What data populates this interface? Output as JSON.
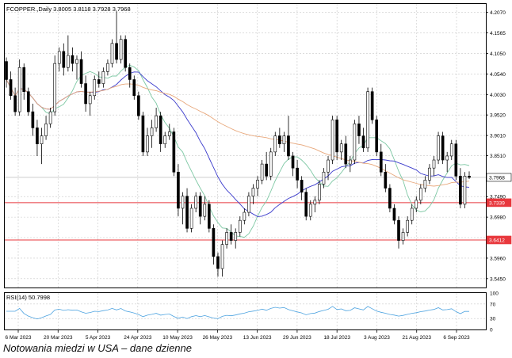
{
  "header": {
    "symbol_line": "FCOPPER.,Daily  3.8005 3.8118 3.7928 3.7968"
  },
  "rsi": {
    "label": "RSI(14) 50.7998",
    "levels": [
      "100",
      "70",
      "30",
      "0"
    ]
  },
  "caption": "Notowania miedzi w USA – dane dzienne",
  "chart_data": {
    "type": "candlestick",
    "title": "FCOPPER.,Daily  3.8005 3.8118 3.7928 3.7968",
    "timeframe": "Daily",
    "ohlc_last": {
      "open": 3.8005,
      "high": 3.8118,
      "low": 3.7928,
      "close": 3.7968
    },
    "ylim": [
      3.523,
      4.228
    ],
    "y_ticks": [
      "4.2070",
      "4.1565",
      "4.1050",
      "4.0540",
      "4.0030",
      "3.9520",
      "3.9010",
      "3.8510",
      "3.7490",
      "3.6980",
      "3.6470",
      "3.5960",
      "3.5450"
    ],
    "x_tick_labels": [
      "6 Mar 2023",
      "20 Mar 2023",
      "5 Apr 2023",
      "24 Apr 2023",
      "10 May 2023",
      "26 May 2023",
      "13 Jun 2023",
      "29 Jun 2023",
      "18 Jul 2023",
      "3 Aug 2023",
      "21 Aug 2023",
      "6 Sep 2023"
    ],
    "price_labels": [
      {
        "text": "3.7968",
        "value": 3.7968,
        "color": "#000000"
      },
      {
        "text": "3.7339",
        "value": 3.7339,
        "color": "#e8383d"
      },
      {
        "text": "3.6412",
        "value": 3.6412,
        "color": "#e8383d"
      }
    ],
    "horizontal_lines": [
      {
        "value": 3.7339,
        "color": "#e8383d"
      },
      {
        "value": 3.6412,
        "color": "#e8383d"
      }
    ],
    "series": [
      {
        "kind": "moving_average",
        "color": "#7ec8a4",
        "role": "fast MA"
      },
      {
        "kind": "moving_average",
        "color": "#3b3bcc",
        "role": "medium MA"
      },
      {
        "kind": "moving_average",
        "color": "#e8a87c",
        "role": "slow MA"
      }
    ],
    "candles": [
      [
        4.085,
        4.095,
        4.02,
        4.04
      ],
      [
        4.04,
        4.06,
        3.99,
        4.0
      ],
      [
        4.0,
        4.02,
        3.95,
        3.96
      ],
      [
        3.96,
        4.09,
        3.95,
        4.07
      ],
      [
        4.07,
        4.08,
        3.99,
        4.01
      ],
      [
        4.01,
        4.02,
        3.95,
        3.96
      ],
      [
        3.96,
        3.98,
        3.9,
        3.92
      ],
      [
        3.92,
        3.94,
        3.85,
        3.88
      ],
      [
        3.88,
        3.92,
        3.83,
        3.9
      ],
      [
        3.9,
        3.95,
        3.89,
        3.93
      ],
      [
        3.93,
        3.97,
        3.92,
        3.96
      ],
      [
        3.96,
        4.1,
        3.95,
        4.08
      ],
      [
        4.08,
        4.12,
        4.06,
        4.11
      ],
      [
        4.11,
        4.13,
        4.05,
        4.07
      ],
      [
        4.07,
        4.15,
        4.06,
        4.1
      ],
      [
        4.1,
        4.12,
        4.06,
        4.08
      ],
      [
        4.08,
        4.1,
        4.04,
        4.09
      ],
      [
        4.09,
        4.11,
        4.02,
        4.03
      ],
      [
        4.03,
        4.05,
        3.96,
        3.98
      ],
      [
        3.98,
        4.01,
        3.95,
        4.0
      ],
      [
        4.0,
        4.05,
        3.99,
        4.04
      ],
      [
        4.04,
        4.06,
        4.02,
        4.03
      ],
      [
        4.03,
        4.07,
        4.02,
        4.06
      ],
      [
        4.06,
        4.09,
        4.05,
        4.08
      ],
      [
        4.08,
        4.14,
        4.07,
        4.13
      ],
      [
        4.13,
        4.21,
        4.08,
        4.09
      ],
      [
        4.09,
        4.15,
        4.08,
        4.14
      ],
      [
        4.14,
        4.15,
        4.06,
        4.07
      ],
      [
        4.07,
        4.08,
        4.02,
        4.04
      ],
      [
        4.04,
        4.05,
        3.99,
        4.0
      ],
      [
        4.0,
        4.01,
        3.94,
        3.95
      ],
      [
        3.95,
        3.96,
        3.85,
        3.86
      ],
      [
        3.86,
        3.92,
        3.85,
        3.9
      ],
      [
        3.9,
        3.94,
        3.87,
        3.92
      ],
      [
        3.92,
        3.97,
        3.91,
        3.95
      ],
      [
        3.95,
        3.96,
        3.86,
        3.88
      ],
      [
        3.88,
        3.91,
        3.87,
        3.9
      ],
      [
        3.9,
        3.93,
        3.89,
        3.91
      ],
      [
        3.91,
        3.92,
        3.8,
        3.81
      ],
      [
        3.81,
        3.83,
        3.7,
        3.72
      ],
      [
        3.72,
        3.76,
        3.68,
        3.75
      ],
      [
        3.75,
        3.77,
        3.66,
        3.67
      ],
      [
        3.67,
        3.73,
        3.66,
        3.72
      ],
      [
        3.72,
        3.76,
        3.71,
        3.75
      ],
      [
        3.75,
        3.76,
        3.68,
        3.7
      ],
      [
        3.7,
        3.75,
        3.69,
        3.73
      ],
      [
        3.73,
        3.74,
        3.66,
        3.67
      ],
      [
        3.67,
        3.68,
        3.58,
        3.6
      ],
      [
        3.6,
        3.61,
        3.55,
        3.57
      ],
      [
        3.57,
        3.64,
        3.55,
        3.63
      ],
      [
        3.63,
        3.67,
        3.62,
        3.66
      ],
      [
        3.66,
        3.68,
        3.63,
        3.64
      ],
      [
        3.64,
        3.67,
        3.62,
        3.66
      ],
      [
        3.66,
        3.7,
        3.65,
        3.69
      ],
      [
        3.69,
        3.72,
        3.68,
        3.71
      ],
      [
        3.71,
        3.76,
        3.7,
        3.75
      ],
      [
        3.75,
        3.78,
        3.73,
        3.77
      ],
      [
        3.77,
        3.8,
        3.75,
        3.79
      ],
      [
        3.79,
        3.84,
        3.78,
        3.83
      ],
      [
        3.83,
        3.86,
        3.79,
        3.8
      ],
      [
        3.8,
        3.87,
        3.79,
        3.86
      ],
      [
        3.86,
        3.91,
        3.85,
        3.9
      ],
      [
        3.9,
        3.92,
        3.87,
        3.88
      ],
      [
        3.88,
        3.91,
        3.86,
        3.9
      ],
      [
        3.9,
        3.95,
        3.84,
        3.85
      ],
      [
        3.85,
        3.86,
        3.8,
        3.82
      ],
      [
        3.82,
        3.84,
        3.77,
        3.79
      ],
      [
        3.79,
        3.8,
        3.74,
        3.76
      ],
      [
        3.76,
        3.77,
        3.69,
        3.7
      ],
      [
        3.7,
        3.74,
        3.69,
        3.73
      ],
      [
        3.73,
        3.75,
        3.71,
        3.74
      ],
      [
        3.74,
        3.79,
        3.73,
        3.78
      ],
      [
        3.78,
        3.82,
        3.77,
        3.81
      ],
      [
        3.81,
        3.85,
        3.79,
        3.84
      ],
      [
        3.84,
        3.95,
        3.83,
        3.94
      ],
      [
        3.94,
        3.95,
        3.84,
        3.86
      ],
      [
        3.86,
        3.89,
        3.84,
        3.88
      ],
      [
        3.88,
        3.9,
        3.82,
        3.83
      ],
      [
        3.83,
        3.85,
        3.81,
        3.84
      ],
      [
        3.84,
        3.94,
        3.83,
        3.93
      ],
      [
        3.93,
        3.95,
        3.88,
        3.9
      ],
      [
        3.9,
        3.92,
        3.86,
        3.87
      ],
      [
        3.87,
        4.02,
        3.86,
        4.01
      ],
      [
        4.01,
        4.02,
        3.93,
        3.94
      ],
      [
        3.94,
        3.95,
        3.85,
        3.86
      ],
      [
        3.86,
        3.88,
        3.8,
        3.81
      ],
      [
        3.81,
        3.83,
        3.76,
        3.77
      ],
      [
        3.77,
        3.78,
        3.71,
        3.72
      ],
      [
        3.72,
        3.73,
        3.68,
        3.69
      ],
      [
        3.69,
        3.7,
        3.62,
        3.64
      ],
      [
        3.64,
        3.67,
        3.63,
        3.66
      ],
      [
        3.66,
        3.7,
        3.65,
        3.69
      ],
      [
        3.69,
        3.73,
        3.68,
        3.72
      ],
      [
        3.72,
        3.75,
        3.71,
        3.74
      ],
      [
        3.74,
        3.78,
        3.73,
        3.77
      ],
      [
        3.77,
        3.8,
        3.76,
        3.79
      ],
      [
        3.79,
        3.83,
        3.78,
        3.82
      ],
      [
        3.82,
        3.85,
        3.8,
        3.84
      ],
      [
        3.84,
        3.91,
        3.83,
        3.9
      ],
      [
        3.9,
        3.91,
        3.83,
        3.84
      ],
      [
        3.84,
        3.86,
        3.81,
        3.85
      ],
      [
        3.85,
        3.89,
        3.84,
        3.88
      ],
      [
        3.88,
        3.89,
        3.79,
        3.8
      ],
      [
        3.8,
        3.82,
        3.72,
        3.73
      ],
      [
        3.73,
        3.81,
        3.72,
        3.8
      ],
      [
        3.8,
        3.8118,
        3.7928,
        3.7968
      ]
    ]
  }
}
